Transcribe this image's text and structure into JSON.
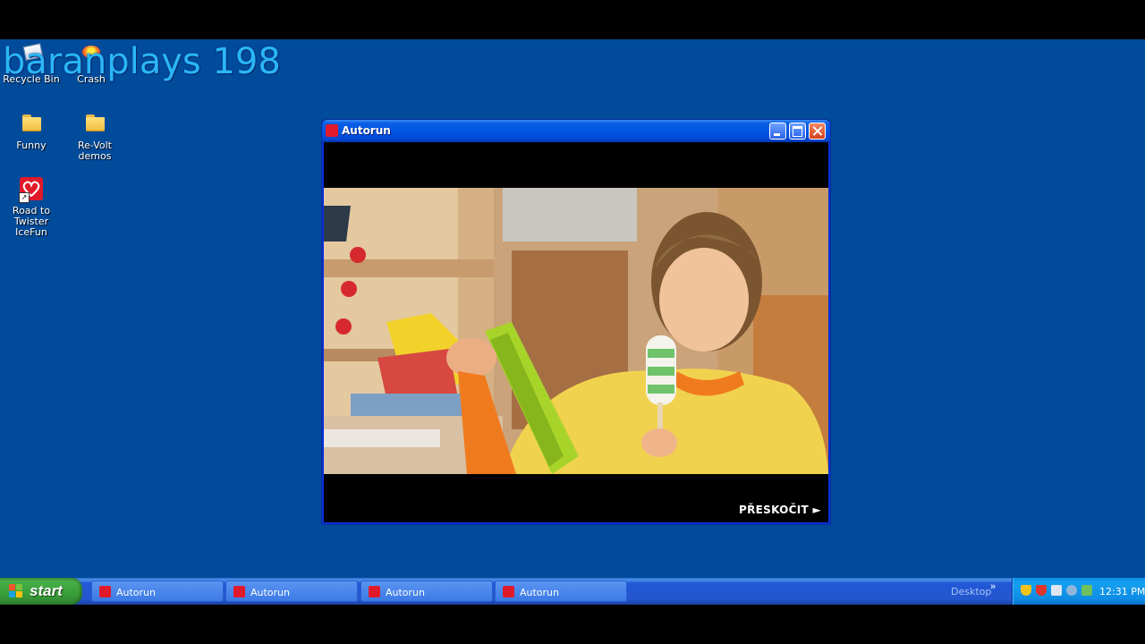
{
  "overlay": {
    "title": "baranplays 198"
  },
  "desktop": {
    "icons": [
      {
        "label": "Recycle Bin",
        "icon": "recycle-bin-icon"
      },
      {
        "label": "Crash",
        "icon": "crash-icon"
      },
      {
        "label": "Funny",
        "icon": "folder-icon"
      },
      {
        "label": "Re-Volt demos",
        "icon": "folder-icon"
      },
      {
        "label": "Road to Twister IceFun",
        "icon": "wall-logo-icon"
      }
    ]
  },
  "window": {
    "title": "Autorun",
    "skip_label": "PŘESKOČIT ►",
    "controls": [
      "minimize",
      "maximize",
      "close"
    ]
  },
  "taskbar": {
    "start_label": "start",
    "tasks": [
      {
        "label": "Autorun"
      },
      {
        "label": "Autorun"
      },
      {
        "label": "Autorun"
      },
      {
        "label": "Autorun"
      }
    ],
    "toolbar_label": "Desktop",
    "toolbar_chevron": "»",
    "clock": "12:31 PM"
  },
  "colors": {
    "desktop": "#014b9b",
    "taskbar": "#2457ce",
    "start": "#3a9d3a",
    "tray": "#0f8be3",
    "brand_red": "#e01a2b"
  }
}
